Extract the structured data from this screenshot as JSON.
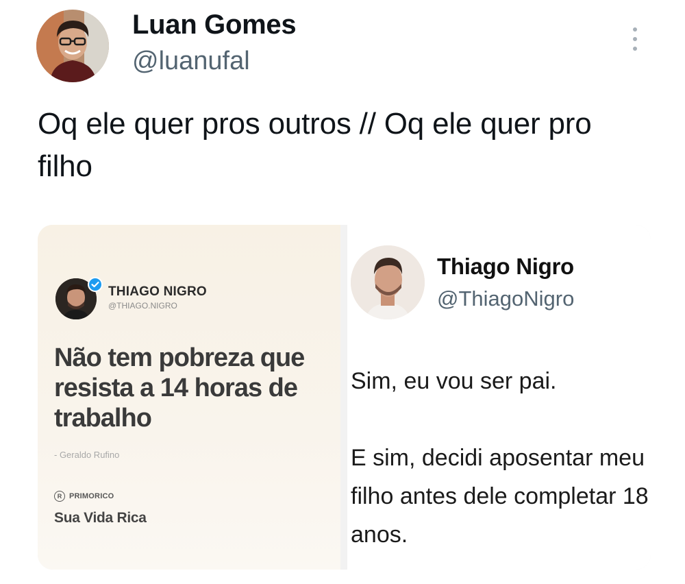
{
  "tweet": {
    "author_name": "Luan Gomes",
    "author_handle": "@luanufal",
    "text": "Oq ele quer pros outros // Oq ele quer pro filho",
    "more_icon": "more-vertical-icon"
  },
  "media": {
    "left": {
      "name": "THIAGO NIGRO",
      "handle": "@THIAGO.NIGRO",
      "verified_icon": "verified-badge-icon",
      "quote": "Não tem pobreza que resista a 14 horas de trabalho",
      "quote_author": "- Geraldo Rufino",
      "brand_logo": "R",
      "brand_name": "PRIMORICO",
      "brand_tag": "Sua Vida Rica"
    },
    "right": {
      "name": "Thiago Nigro",
      "handle": "@ThiagoNigro",
      "text_line1": "Sim, eu vou ser pai.",
      "text_line2": "E sim, decidi aposentar meu filho antes dele completar 18 anos."
    }
  },
  "colors": {
    "handle_gray": "#536471",
    "verified_blue": "#1d9bf0"
  }
}
